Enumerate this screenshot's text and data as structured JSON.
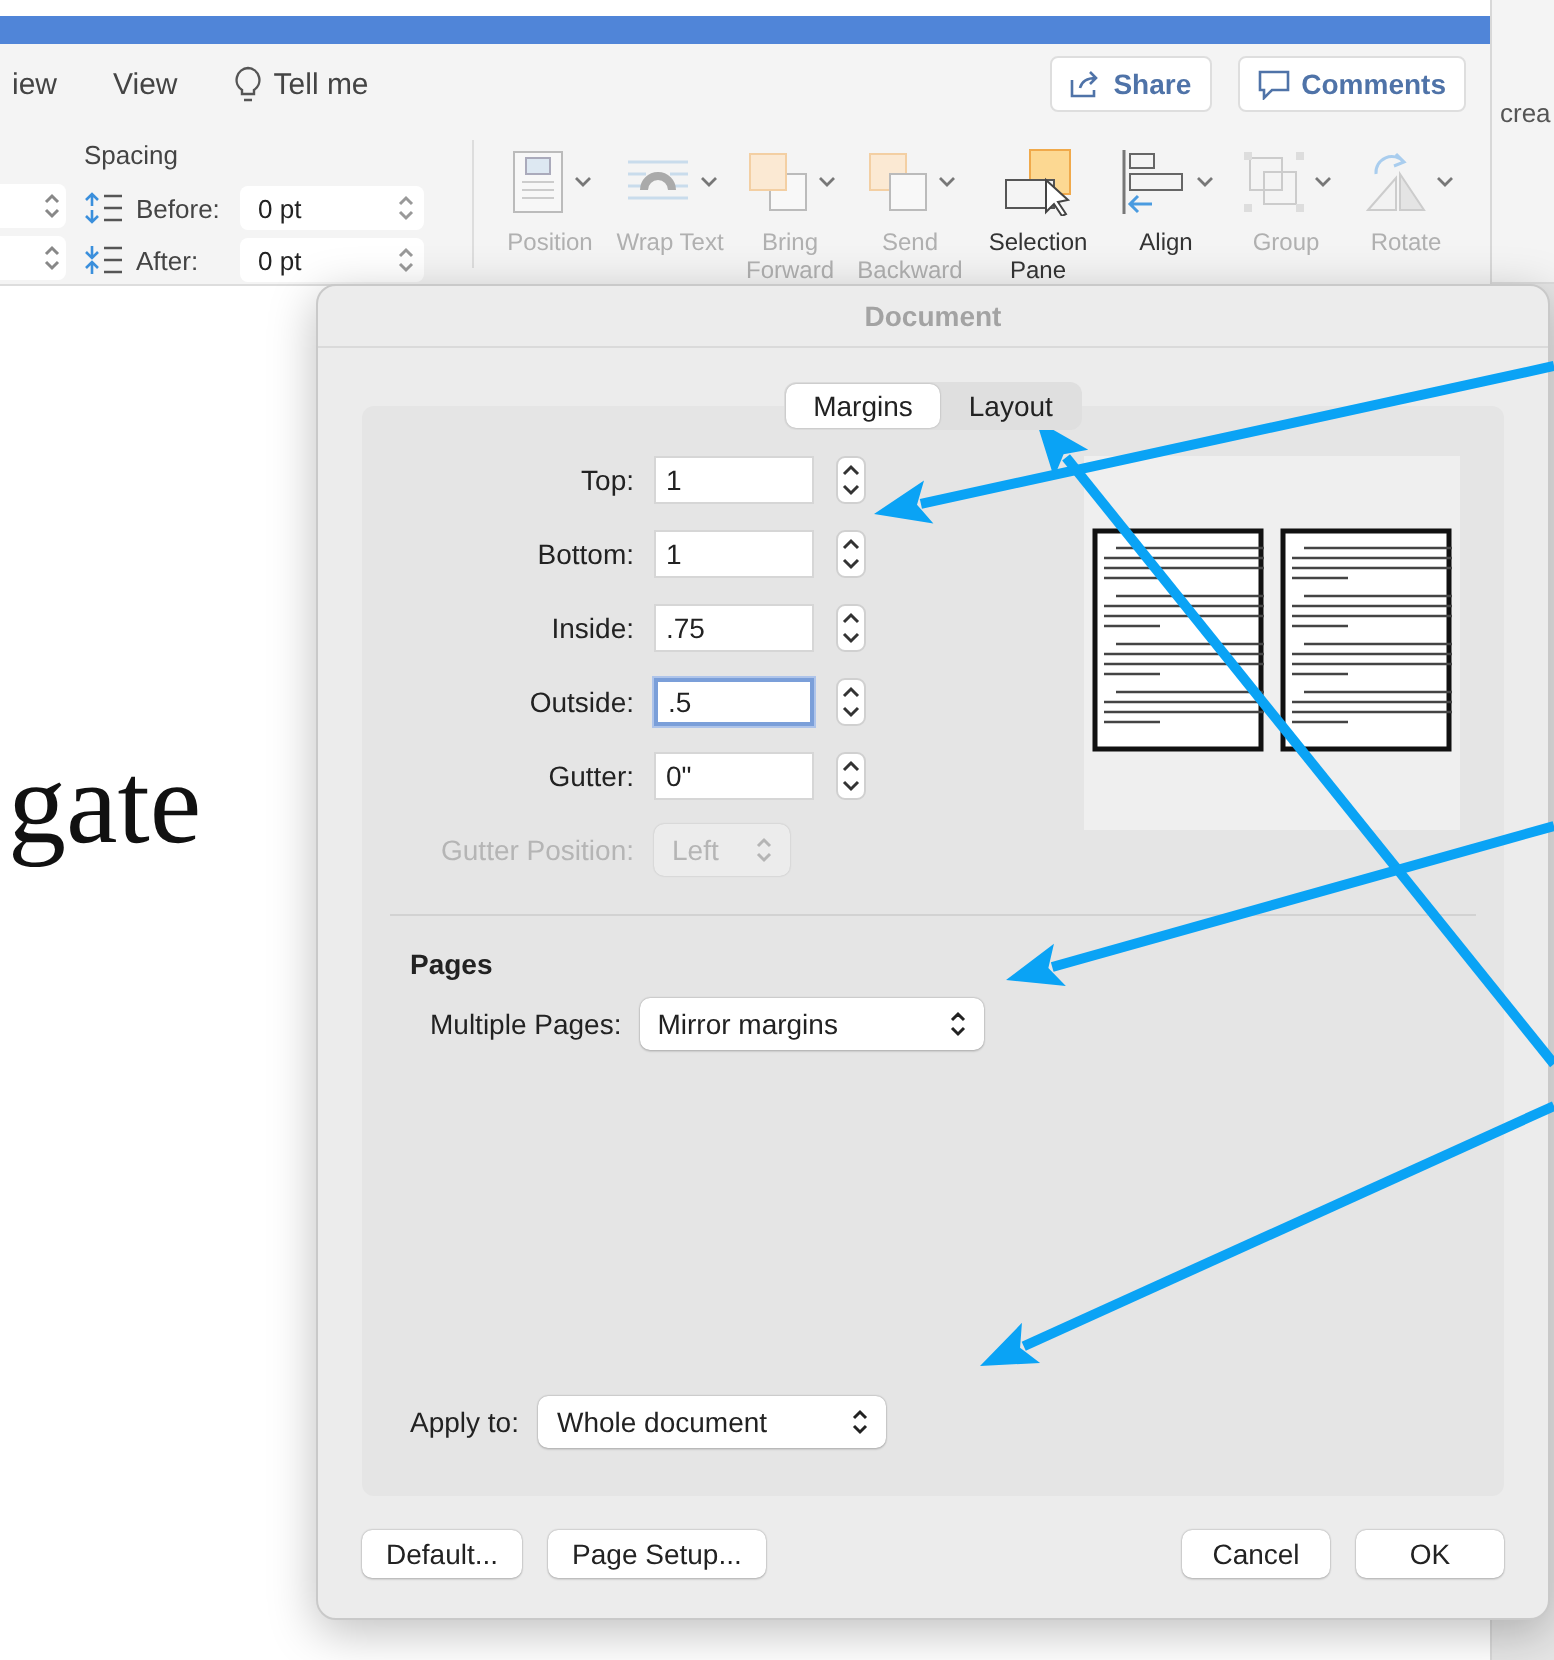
{
  "menu": {
    "tabs": [
      {
        "label": "iew"
      },
      {
        "label": "View"
      }
    ],
    "tell_me": "Tell me",
    "share": "Share",
    "comments": "Comments"
  },
  "ribbon": {
    "spacing_title": "Spacing",
    "spacing": [
      {
        "kind": "before",
        "label": "Before:",
        "value": "0 pt"
      },
      {
        "kind": "after",
        "label": "After:",
        "value": "0 pt"
      }
    ],
    "tools": [
      {
        "kind": "position",
        "label": "Position",
        "disabled": true,
        "dropdown": true
      },
      {
        "kind": "wrap",
        "label": "Wrap Text",
        "disabled": true,
        "dropdown": true
      },
      {
        "kind": "bring",
        "label": "Bring Forward",
        "disabled": true,
        "dropdown": true
      },
      {
        "kind": "send",
        "label": "Send Backward",
        "disabled": true,
        "dropdown": true
      },
      {
        "kind": "selection",
        "label": "Selection Pane",
        "disabled": false,
        "dropdown": false
      },
      {
        "kind": "align",
        "label": "Align",
        "disabled": false,
        "dropdown": true
      },
      {
        "kind": "group",
        "label": "Group",
        "disabled": true,
        "dropdown": true
      },
      {
        "kind": "rotate",
        "label": "Rotate",
        "disabled": true,
        "dropdown": true
      }
    ]
  },
  "side_panel": {
    "text": "crea"
  },
  "document": {
    "text": "gate"
  },
  "dialog": {
    "title": "Document",
    "tabs": [
      {
        "label": "Margins",
        "selected": true
      },
      {
        "label": "Layout",
        "selected": false
      }
    ],
    "fields": [
      {
        "label": "Top:",
        "value": "1",
        "focused": false
      },
      {
        "label": "Bottom:",
        "value": "1",
        "focused": false
      },
      {
        "label": "Inside:",
        "value": ".75",
        "focused": false
      },
      {
        "label": "Outside:",
        "value": ".5",
        "focused": true
      },
      {
        "label": "Gutter:",
        "value": "0\"",
        "focused": false
      }
    ],
    "gutter_position": {
      "label": "Gutter Position:",
      "value": "Left",
      "disabled": true
    },
    "pages": {
      "heading": "Pages",
      "label": "Multiple Pages:",
      "value": "Mirror margins"
    },
    "apply": {
      "label": "Apply to:",
      "value": "Whole document"
    },
    "left_buttons": [
      "Default...",
      "Page Setup..."
    ],
    "right_buttons": [
      "Cancel",
      "OK"
    ]
  }
}
